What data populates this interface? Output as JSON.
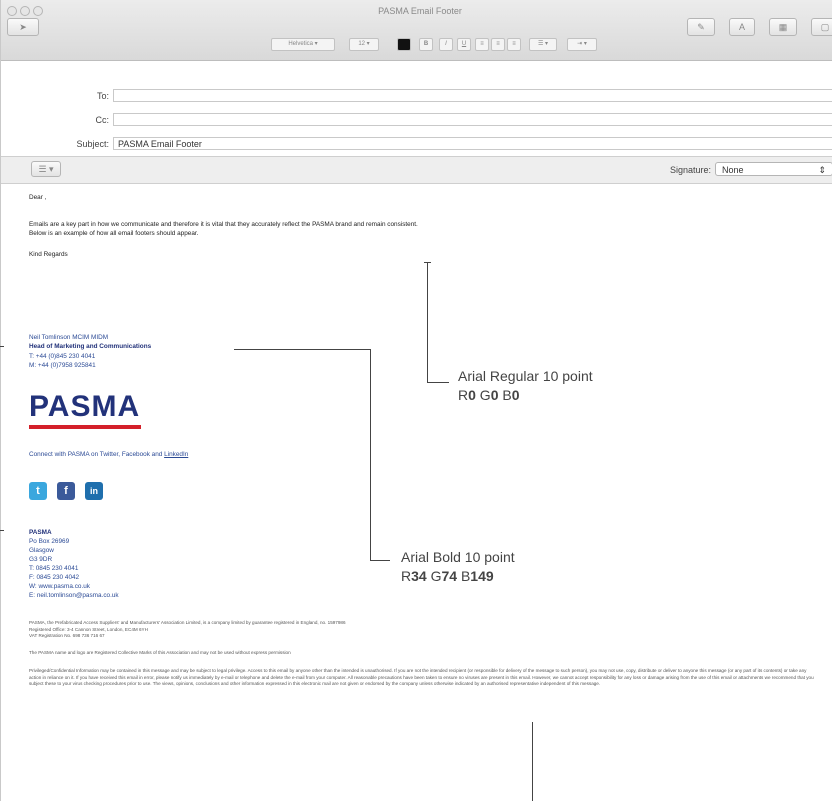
{
  "window": {
    "title": "PASMA Email Footer"
  },
  "toolbar": {
    "font_name": "Helvetica",
    "font_size": "12",
    "list_label": "☰ ▾",
    "indent_label": "⇥ ▾"
  },
  "header": {
    "to_label": "To:",
    "to_value": "",
    "cc_label": "Cc:",
    "cc_value": "",
    "subject_label": "Subject:",
    "subject_value": "PASMA Email Footer",
    "signature_label": "Signature:",
    "signature_value": "None"
  },
  "body": {
    "greeting": "Dear ,",
    "line1": "Emails are a key part in how we communicate and therefore it is vital that they accurately reflect the PASMA brand and remain consistent.",
    "line2": "Below is an example of how all email footers should appear.",
    "regards": "Kind Regards"
  },
  "signature": {
    "name": "Neil Tomlinson MCIM MIDM",
    "role": "Head of Marketing and Communications",
    "tel": "T: +44 (0)845 230 4041",
    "mobile": "M: +44 (0)7958 925841",
    "logo_text": "PASMA",
    "connect_prefix": "Connect with PASMA on Twitter, Facebook and ",
    "connect_link": "LinkedIn",
    "org": "PASMA",
    "addr1": "Po Box 26969",
    "addr2": "Glasgow",
    "addr3": "G3 9DR",
    "addr_t": "T: 0845 230 4041",
    "addr_f": "F: 0845 230 4042",
    "addr_w": "W: www.pasma.co.uk",
    "addr_e": "E: neil.tomlinson@pasma.co.uk"
  },
  "legal": {
    "p1a": "PASMA, the Prefabricated Access Suppliers' and Manufacturers' Association Limited, is a company limited by guarantee registered in England, no. 1597986",
    "p1b": "Registered Office: 3-4 Cannon Street, London, EC4M 6YH",
    "p1c": "VAT Registration No. 698 736 716 67",
    "p2": "The PASMA name and logo are Registered Collective Marks of this Association and may not be used without express permission",
    "p3": "Privileged/Confidential Information may be contained in this message and may be subject to legal privilege. Access to this email by anyone other than the intended is unauthorised. If you are not the intended recipient (or responsible for delivery of the message to such person), you may not use, copy, distribute or deliver to anyone this message (or any part of its contents) or take any action in reliance on it. If you have received this email in error, please notify us immediately by e-mail or telephone and delete the e-mail from your computer. All reasonable precautions have been taken to ensure no viruses are present in this email. However, we cannot accept responsibility for any loss or damage arising from the use of this email or attachments we recommend that you subject these to your virus checking procedures prior to use. The views, opinions, conclusions and other information expressed in this electronic mail are not given or endorsed by the company unless otherwise indicated by an authorised representative independent of this message."
  },
  "annotations": {
    "regular_title": "Arial Regular 10 point",
    "regular_rgb": {
      "r_label": "R",
      "r": "0",
      "g_label": " G",
      "g": "0",
      "b_label": " B",
      "b": "0"
    },
    "bold_title": "Arial Bold 10 point",
    "bold_rgb": {
      "r_label": "R",
      "r": "34",
      "g_label": " G",
      "g": "74",
      "b_label": " B",
      "b": "149"
    }
  },
  "colors": {
    "brand_blue": "#224A95",
    "logo_red": "#d4202a",
    "twitter": "#3aa7de",
    "facebook": "#3b5a9a",
    "linkedin": "#1f6fad"
  }
}
